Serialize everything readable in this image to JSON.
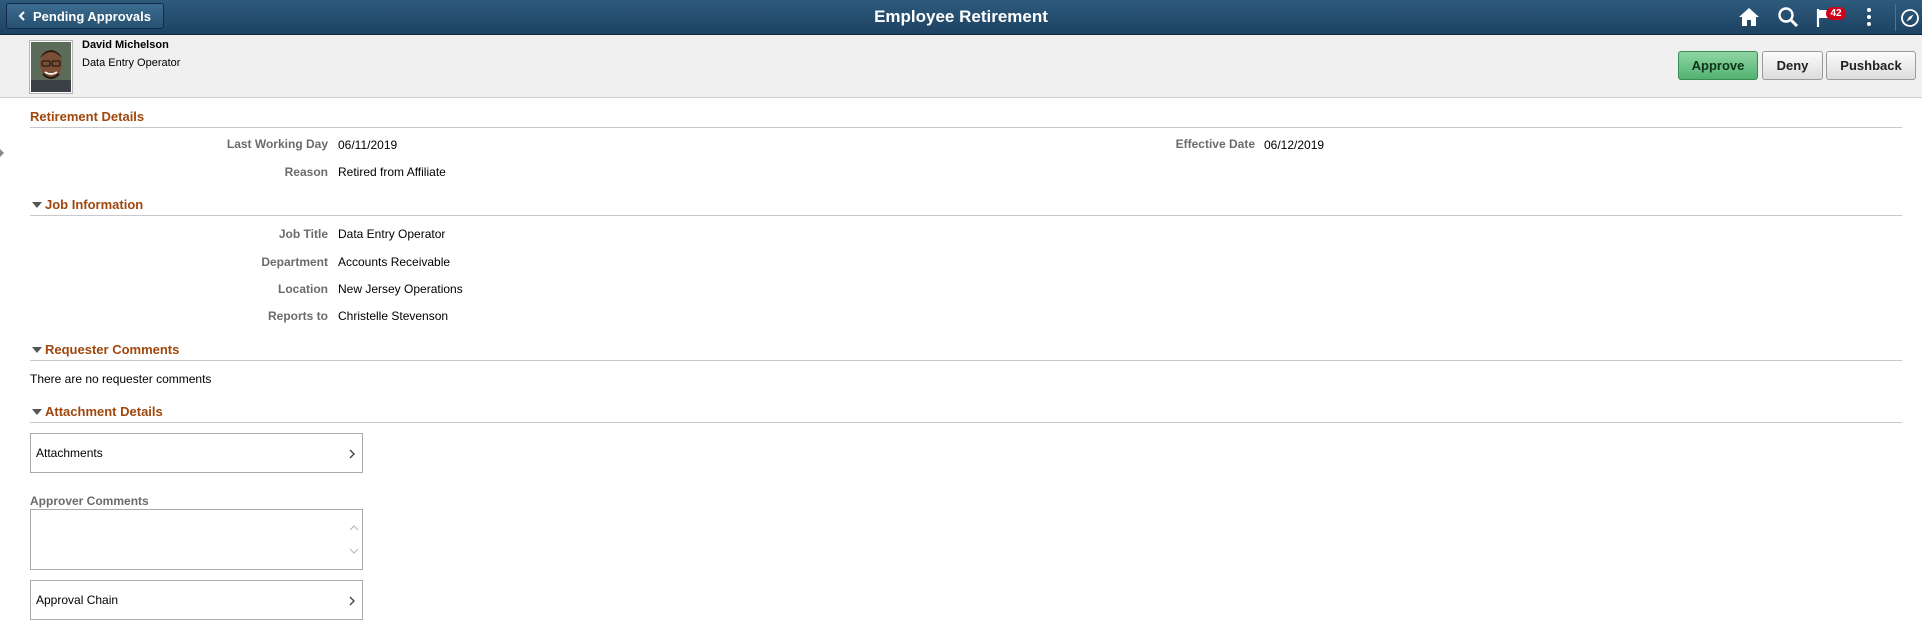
{
  "header": {
    "back_label": "Pending Approvals",
    "title": "Employee Retirement",
    "notification_count": "42",
    "icons": [
      "home-icon",
      "search-icon",
      "flag-icon",
      "more-icon",
      "navbar-icon"
    ],
    "bar_color": "#23496a"
  },
  "employee": {
    "name": "David Michelson",
    "job_title": "Data Entry Operator"
  },
  "actions": {
    "approve": "Approve",
    "deny": "Deny",
    "pushback": "Pushback"
  },
  "retirement_details": {
    "heading": "Retirement Details",
    "last_working_day_label": "Last Working Day",
    "last_working_day": "06/11/2019",
    "effective_date_label": "Effective Date",
    "effective_date": "06/12/2019",
    "reason_label": "Reason",
    "reason": "Retired from Affiliate"
  },
  "job_information": {
    "heading": "Job Information",
    "fields": [
      {
        "label": "Job Title",
        "value": "Data Entry Operator"
      },
      {
        "label": "Department",
        "value": "Accounts Receivable"
      },
      {
        "label": "Location",
        "value": "New Jersey Operations"
      },
      {
        "label": "Reports to",
        "value": "Christelle Stevenson"
      }
    ]
  },
  "requester_comments": {
    "heading": "Requester Comments",
    "text": "There are no requester comments"
  },
  "attachment_details": {
    "heading": "Attachment Details",
    "attachments_label": "Attachments"
  },
  "approver_comments": {
    "label": "Approver Comments",
    "value": ""
  },
  "approval_chain": {
    "label": "Approval Chain"
  },
  "colors": {
    "section_heading": "#a0470d",
    "approve": "#5cb97a"
  }
}
